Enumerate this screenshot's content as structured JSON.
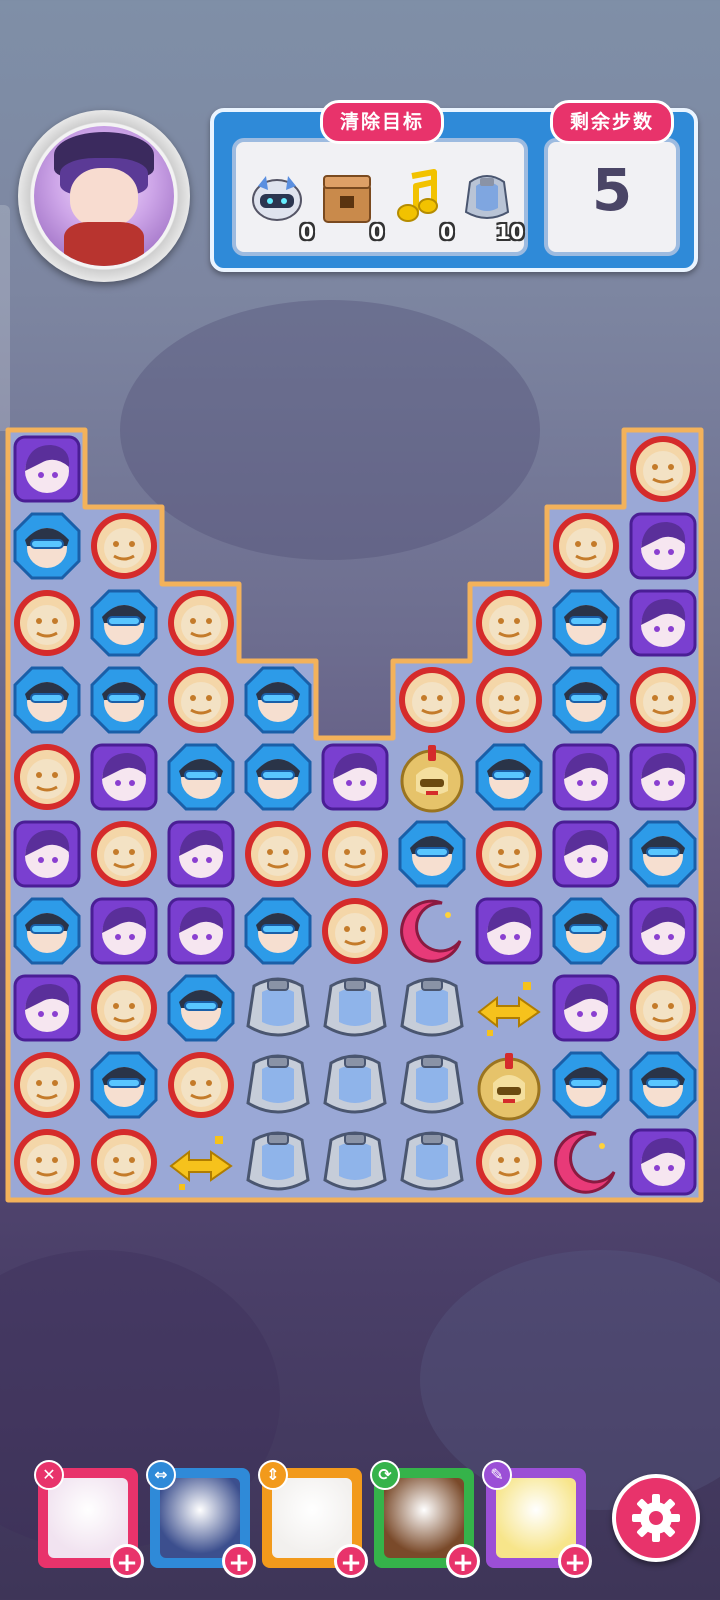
{
  "goals": {
    "title": "清除目标",
    "items": [
      {
        "icon": "robot-helmet-icon",
        "count": "0"
      },
      {
        "icon": "crate-box-icon",
        "count": "0"
      },
      {
        "icon": "music-note-icon",
        "count": "0"
      },
      {
        "icon": "armor-icon",
        "count": "10"
      }
    ]
  },
  "moves": {
    "title": "剩余步数",
    "value": "5"
  },
  "board": {
    "columns": 9,
    "rows": 10,
    "grid": [
      [
        "purple",
        null,
        null,
        null,
        null,
        null,
        null,
        null,
        "red"
      ],
      [
        "blue",
        "red",
        null,
        null,
        null,
        null,
        null,
        "red",
        "purple"
      ],
      [
        "red",
        "blue",
        "red",
        null,
        null,
        null,
        "red",
        "blue",
        "purple"
      ],
      [
        "blue",
        "blue",
        "red",
        "blue",
        null,
        "red",
        "red",
        "blue",
        "red"
      ],
      [
        "red",
        "purple",
        "blue",
        "blue",
        "purple",
        "gold",
        "blue",
        "purple",
        "purple"
      ],
      [
        "purple",
        "red",
        "purple",
        "red",
        "red",
        "blue",
        "red",
        "purple",
        "blue"
      ],
      [
        "blue",
        "purple",
        "purple",
        "blue",
        "red",
        "moon",
        "purple",
        "blue",
        "purple"
      ],
      [
        "purple",
        "red",
        "blue",
        "armor",
        "armor",
        "armor",
        "arrows",
        "purple",
        "red"
      ],
      [
        "red",
        "blue",
        "red",
        "armor",
        "armor",
        "armor",
        "gold",
        "blue",
        "blue"
      ],
      [
        "red",
        "red",
        "arrows",
        "armor",
        "armor",
        "armor",
        "red",
        "moon",
        "purple"
      ]
    ]
  },
  "heroes": [
    {
      "name": "hero-white-hat",
      "badge": "✕",
      "badge_color": "#e8336b",
      "frame": "#e8336b"
    },
    {
      "name": "hero-masked",
      "badge": "⇔",
      "badge_color": "#2f8ad8",
      "frame": "#2f8ad8"
    },
    {
      "name": "hero-white-hair",
      "badge": "⇕",
      "badge_color": "#f29a1c",
      "frame": "#f29a1c"
    },
    {
      "name": "hero-brown-hair",
      "badge": "⟳",
      "badge_color": "#35b34a",
      "frame": "#35b34a"
    },
    {
      "name": "hero-blonde",
      "badge": "✎",
      "badge_color": "#9b4fd6",
      "frame": "#9b4fd6"
    }
  ],
  "colors": {
    "accent": "#e8336b",
    "panel": "#2f8ad8",
    "board_fill": "#9aa8d6",
    "board_border": "#f3b25b"
  }
}
